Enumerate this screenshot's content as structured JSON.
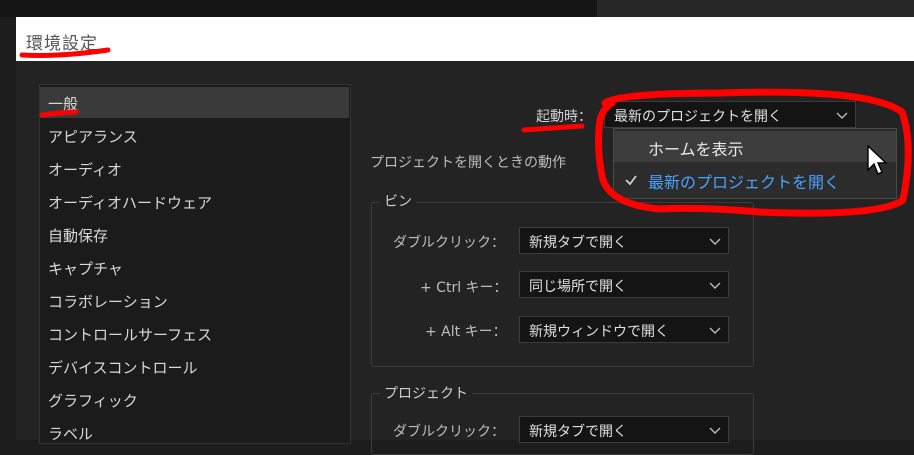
{
  "window": {
    "title": "環境設定"
  },
  "sidebar": {
    "items": [
      {
        "label": "一般",
        "selected": true
      },
      {
        "label": "アピアランス"
      },
      {
        "label": "オーディオ"
      },
      {
        "label": "オーディオハードウェア"
      },
      {
        "label": "自動保存"
      },
      {
        "label": "キャプチャ"
      },
      {
        "label": "コラボレーション"
      },
      {
        "label": "コントロールサーフェス"
      },
      {
        "label": "デバイスコントロール"
      },
      {
        "label": "グラフィック"
      },
      {
        "label": "ラベル"
      }
    ]
  },
  "startup": {
    "label": "起動時：",
    "selected": "最新のプロジェクトを開く",
    "options": [
      "ホームを表示",
      "最新のプロジェクトを開く"
    ],
    "open_project_label": "プロジェクトを開くときの動作"
  },
  "bins": {
    "legend": "ビン",
    "double_click": {
      "label": "ダブルクリック：",
      "value": "新規タブで開く"
    },
    "ctrl": {
      "label": "+ Ctrl キー：",
      "value": "同じ場所で開く"
    },
    "alt": {
      "label": "+ Alt キー：",
      "value": "新規ウィンドウで開く"
    }
  },
  "project": {
    "legend": "プロジェクト",
    "double_click": {
      "label": "ダブルクリック：",
      "value": "新規タブで開く"
    }
  },
  "colors": {
    "accent": "#4aa3ff",
    "annotation": "#ff0000"
  }
}
